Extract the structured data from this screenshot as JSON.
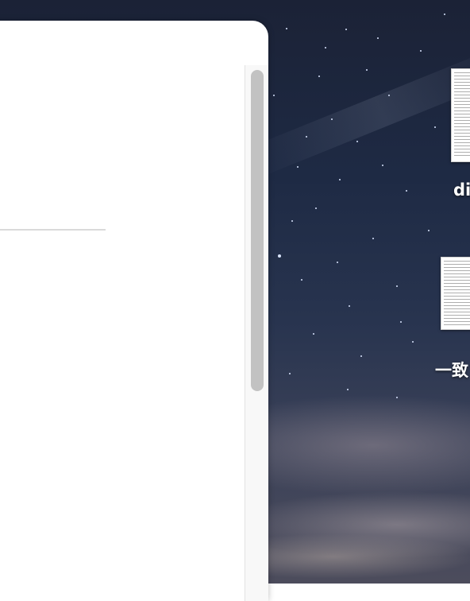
{
  "desktop": {
    "files": [
      {
        "name": "di",
        "icon": "text-document-icon"
      },
      {
        "name": "一致",
        "icon": "text-document-icon"
      }
    ]
  },
  "window": {
    "scrollbar": {
      "scroll_fraction": 0.0
    }
  }
}
